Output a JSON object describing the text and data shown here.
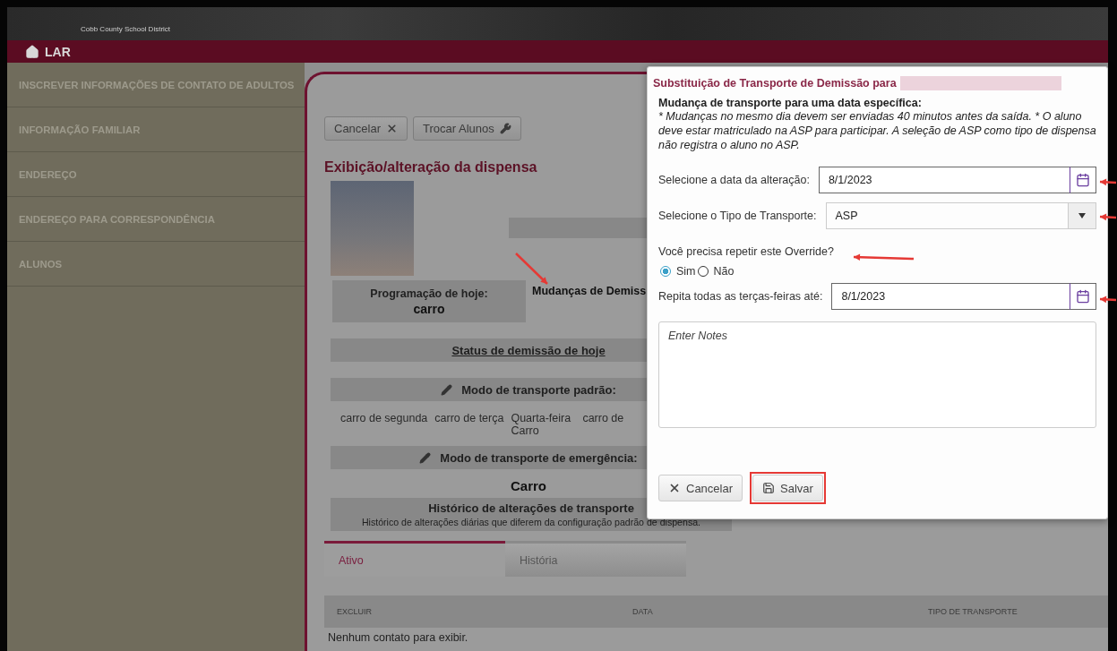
{
  "header": {
    "district": "Cobb County School District"
  },
  "nav": {
    "title": "LAR"
  },
  "sidebar": {
    "items": [
      {
        "label": "INSCREVER INFORMAÇÕES DE CONTATO DE ADULTOS"
      },
      {
        "label": "INFORMAÇÃO FAMILIAR"
      },
      {
        "label": "ENDEREÇO"
      },
      {
        "label": "ENDEREÇO PARA CORRESPONDÊNCIA"
      },
      {
        "label": "ALUNOS"
      }
    ]
  },
  "page": {
    "cancel_button": "Cancelar",
    "switch_button": "Trocar Alunos",
    "title": "Exibição/alteração da dispensa",
    "today_schedule": {
      "label": "Programação de hoje:",
      "value": "carro"
    },
    "changes_label": "Mudanças de Demiss",
    "status_heading": "Status de demissão de hoje",
    "default_mode": {
      "heading": "Modo de transporte padrão:",
      "days": [
        "carro de segunda",
        "carro de terça",
        "Quarta-feira Carro",
        "carro de"
      ]
    },
    "emergency_mode": {
      "heading": "Modo de transporte de emergência:",
      "value": "Carro"
    },
    "history": {
      "title": "Histórico de alterações de transporte",
      "subtitle": "Histórico de alterações diárias que diferem da configuração padrão de dispensa."
    },
    "tabs": [
      {
        "label": "Ativo",
        "selected": true
      },
      {
        "label": "História",
        "selected": false
      }
    ],
    "table": {
      "columns": [
        "EXCLUIR",
        "DATA",
        "TIPO DE TRANSPORTE"
      ],
      "empty": "Nenhum contato para exibir."
    }
  },
  "dialog": {
    "title": "Substituição de Transporte de Demissão para",
    "heading": "Mudança de transporte para uma data específica:",
    "note": "* Mudanças no mesmo dia devem ser enviadas 40 minutos antes da saída. * O aluno deve estar matriculado na ASP para participar. A seleção de ASP como tipo de dispensa não registra o aluno no ASP.",
    "date_label": "Selecione a data da alteração:",
    "date_value": "8/1/2023",
    "type_label": "Selecione o Tipo de Transporte:",
    "type_value": "ASP",
    "repeat_question": "Você precisa repetir este Override?",
    "repeat_options": [
      {
        "label": "Sim",
        "selected": true
      },
      {
        "label": "Não",
        "selected": false
      }
    ],
    "until_label": "Repita todas as terças-feiras até:",
    "until_value": "8/1/2023",
    "notes": {
      "placeholder": "Enter Notes"
    },
    "cancel_button": "Cancelar",
    "save_button": "Salvar"
  }
}
